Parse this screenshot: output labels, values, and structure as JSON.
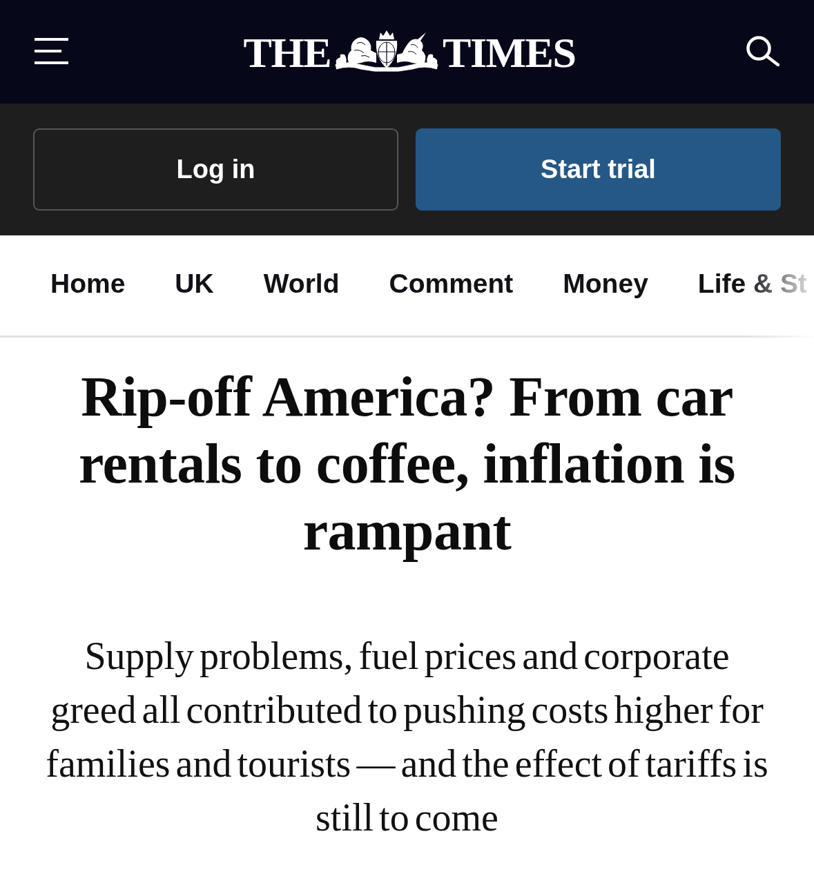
{
  "masthead": {
    "wordmark_left": "THE",
    "wordmark_right": "TIMES"
  },
  "account_bar": {
    "buttons": [
      {
        "label": "Log in",
        "kind": "secondary"
      },
      {
        "label": "Start trial",
        "kind": "primary"
      }
    ]
  },
  "section_nav": {
    "items": [
      {
        "label": "Home"
      },
      {
        "label": "UK"
      },
      {
        "label": "World"
      },
      {
        "label": "Comment"
      },
      {
        "label": "Money"
      },
      {
        "label": "Life & St"
      }
    ]
  },
  "article": {
    "headline": "Rip-off America? From car rentals to coffee, inflation is rampant",
    "standfirst": "Supply problems, fuel prices and corporate greed all contributed to pushing costs higher for families and tourists — and the effect of tariffs is still to come"
  }
}
